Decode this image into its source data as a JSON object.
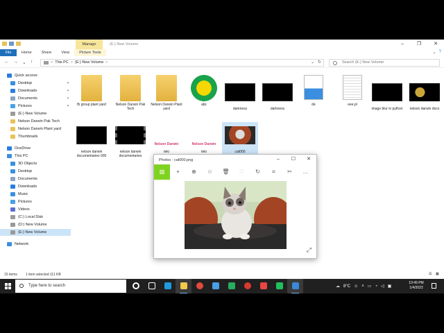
{
  "explorer": {
    "title_path": "(E:) New Volume",
    "manage_tab": "Manage",
    "ribbon_tabs": [
      "File",
      "Home",
      "Share",
      "View",
      "Picture Tools"
    ],
    "address": {
      "parts": [
        "This PC",
        "(E:) New Volume"
      ],
      "separator": ">"
    },
    "search_placeholder": "Search (E:) New Volume",
    "nav": [
      {
        "label": "Quick access",
        "icon": "star-icon",
        "color": "#2a7ee0",
        "level": 0,
        "pinned": false
      },
      {
        "label": "Desktop",
        "icon": "desktop-icon",
        "color": "#3b8fe0",
        "level": 1,
        "pinned": true
      },
      {
        "label": "Downloads",
        "icon": "download-icon",
        "color": "#2a7ee0",
        "level": 1,
        "pinned": true
      },
      {
        "label": "Documents",
        "icon": "documents-icon",
        "color": "#8aa4c4",
        "level": 1,
        "pinned": true
      },
      {
        "label": "Pictures",
        "icon": "pictures-icon",
        "color": "#4aa0e6",
        "level": 1,
        "pinned": true
      },
      {
        "label": "(E:) New Volume",
        "icon": "drive-icon",
        "color": "#9a9a9a",
        "level": 1,
        "pinned": false
      },
      {
        "label": "Nelson Darwin Pak Tech",
        "icon": "folder-icon",
        "color": "#e8c15a",
        "level": 1,
        "pinned": false
      },
      {
        "label": "Nelson Darwin Plant yard",
        "icon": "folder-icon",
        "color": "#e8c15a",
        "level": 1,
        "pinned": false
      },
      {
        "label": "Thumbnails",
        "icon": "folder-icon",
        "color": "#e8c15a",
        "level": 1,
        "pinned": false
      },
      {
        "label": "OneDrive",
        "icon": "cloud-icon",
        "color": "#2a7ee0",
        "level": 0,
        "pinned": false
      },
      {
        "label": "This PC",
        "icon": "pc-icon",
        "color": "#3b8fe0",
        "level": 0,
        "pinned": false
      },
      {
        "label": "3D Objects",
        "icon": "cube-icon",
        "color": "#3b8fe0",
        "level": 1,
        "pinned": false
      },
      {
        "label": "Desktop",
        "icon": "desktop-icon",
        "color": "#3b8fe0",
        "level": 1,
        "pinned": false
      },
      {
        "label": "Documents",
        "icon": "documents-icon",
        "color": "#8aa4c4",
        "level": 1,
        "pinned": false
      },
      {
        "label": "Downloads",
        "icon": "download-icon",
        "color": "#2a7ee0",
        "level": 1,
        "pinned": false
      },
      {
        "label": "Music",
        "icon": "music-icon",
        "color": "#3b8fe0",
        "level": 1,
        "pinned": false
      },
      {
        "label": "Pictures",
        "icon": "pictures-icon",
        "color": "#4aa0e6",
        "level": 1,
        "pinned": false
      },
      {
        "label": "Videos",
        "icon": "videos-icon",
        "color": "#5a6fd0",
        "level": 1,
        "pinned": false
      },
      {
        "label": "(C:) Local Disk",
        "icon": "drive-icon",
        "color": "#9a9a9a",
        "level": 1,
        "pinned": false
      },
      {
        "label": "(D:) New Volume",
        "icon": "drive-icon",
        "color": "#9a9a9a",
        "level": 1,
        "pinned": false
      },
      {
        "label": "(E:) New Volume",
        "icon": "drive-icon",
        "color": "#9a9a9a",
        "level": 1,
        "pinned": false,
        "selected": true
      },
      {
        "label": "Network",
        "icon": "network-icon",
        "color": "#3b8fe0",
        "level": 0,
        "pinned": false
      }
    ],
    "files": [
      {
        "name": "fb group plant yard",
        "kind": "folder"
      },
      {
        "name": "Nelson Darwin Pak Tech",
        "kind": "folder"
      },
      {
        "name": "Nelson Darwin Plant yard",
        "kind": "folder"
      },
      {
        "name": "abc",
        "kind": "logo"
      },
      {
        "name": "darkness",
        "kind": "video"
      },
      {
        "name": "darkness",
        "kind": "video"
      },
      {
        "name": "de",
        "kind": "image-file"
      },
      {
        "name": "eee.pl",
        "kind": "text-file"
      },
      {
        "name": "image blur in python",
        "kind": "video"
      },
      {
        "name": "nelson darwin docs",
        "kind": "logo-dark"
      },
      {
        "name": "nelson darwin documentaries 000",
        "kind": "video"
      },
      {
        "name": "nelson darwin documentaries",
        "kind": "filmstrip"
      },
      {
        "name": "teki",
        "kind": "banner",
        "banner_text": "Nelson Darwin"
      },
      {
        "name": "teki",
        "kind": "banner",
        "banner_text": "Nelson Darwin"
      },
      {
        "name": "cat000",
        "kind": "photo",
        "selected": true
      }
    ],
    "status": {
      "items": "15 items",
      "selected": "1 item selected  111 KB"
    }
  },
  "photos": {
    "title": "Photos - cat000.png",
    "toolbar": [
      "image-icon",
      "add-icon",
      "zoom-in-icon",
      "zoom-out-icon",
      "delete-icon",
      "favorite-icon",
      "rotate-icon",
      "crop-icon",
      "edit-icon",
      "more-icon"
    ]
  },
  "taskbar": {
    "search_placeholder": "Type here to search",
    "apps": [
      {
        "name": "cortana-icon",
        "color": "#ffffff"
      },
      {
        "name": "task-view-icon",
        "color": "#ffffff"
      },
      {
        "name": "edge-icon",
        "color": "#1f9ae0"
      },
      {
        "name": "file-explorer-icon",
        "color": "#f2c94c",
        "active": true
      },
      {
        "name": "chrome-icon",
        "color": "#e24a3b"
      },
      {
        "name": "store-icon",
        "color": "#4a9ee8"
      },
      {
        "name": "vpn-icon",
        "color": "#27ae60"
      },
      {
        "name": "chrome-profile-icon",
        "color": "#d63b30"
      },
      {
        "name": "vscode-icon",
        "color": "#e94545"
      },
      {
        "name": "pycharm-icon",
        "color": "#21c05f"
      },
      {
        "name": "photos-icon",
        "color": "#3b89d8",
        "active": true
      }
    ],
    "temperature": "8°C",
    "time": "10:49 PM",
    "date": "1/4/2022"
  }
}
